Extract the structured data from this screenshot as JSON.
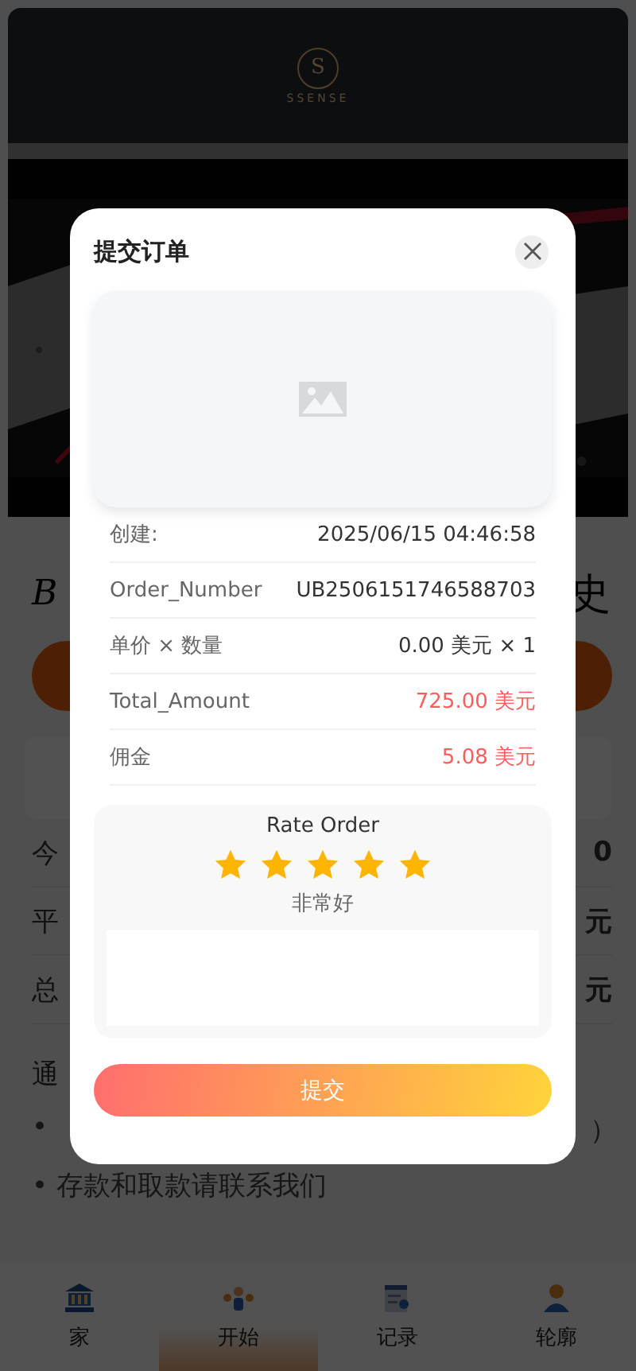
{
  "header": {
    "logo_letter": "S",
    "brand": "SSENSE"
  },
  "page": {
    "script_title": "B",
    "title_end": "史",
    "stats": [
      {
        "label": "今",
        "value": "0"
      },
      {
        "label": "平",
        "value": "元"
      },
      {
        "label": "总",
        "value": "元"
      }
    ],
    "notice_title": "通",
    "notices": [
      {
        "start": "•",
        "end": "）"
      },
      {
        "start": "• 存款和取款请联系我们"
      }
    ]
  },
  "modal": {
    "title": "提交订单",
    "details": [
      {
        "label": "创建:",
        "value": "2025/06/15 04:46:58",
        "highlight": false
      },
      {
        "label": "Order_Number",
        "value": "UB2506151746588703",
        "highlight": false
      },
      {
        "label": "单价 × 数量",
        "value": "0.00 美元 × 1",
        "highlight": false
      },
      {
        "label": "Total_Amount",
        "value": "725.00 美元",
        "highlight": true
      },
      {
        "label": "佣金",
        "value": "5.08 美元",
        "highlight": true
      }
    ],
    "rating": {
      "title": "Rate Order",
      "stars": 5,
      "verdict": "非常好"
    },
    "submit": "提交"
  },
  "nav": [
    {
      "label": "家",
      "selected": false
    },
    {
      "label": "开始",
      "selected": true
    },
    {
      "label": "记录",
      "selected": false
    },
    {
      "label": "轮廓",
      "selected": false
    }
  ]
}
